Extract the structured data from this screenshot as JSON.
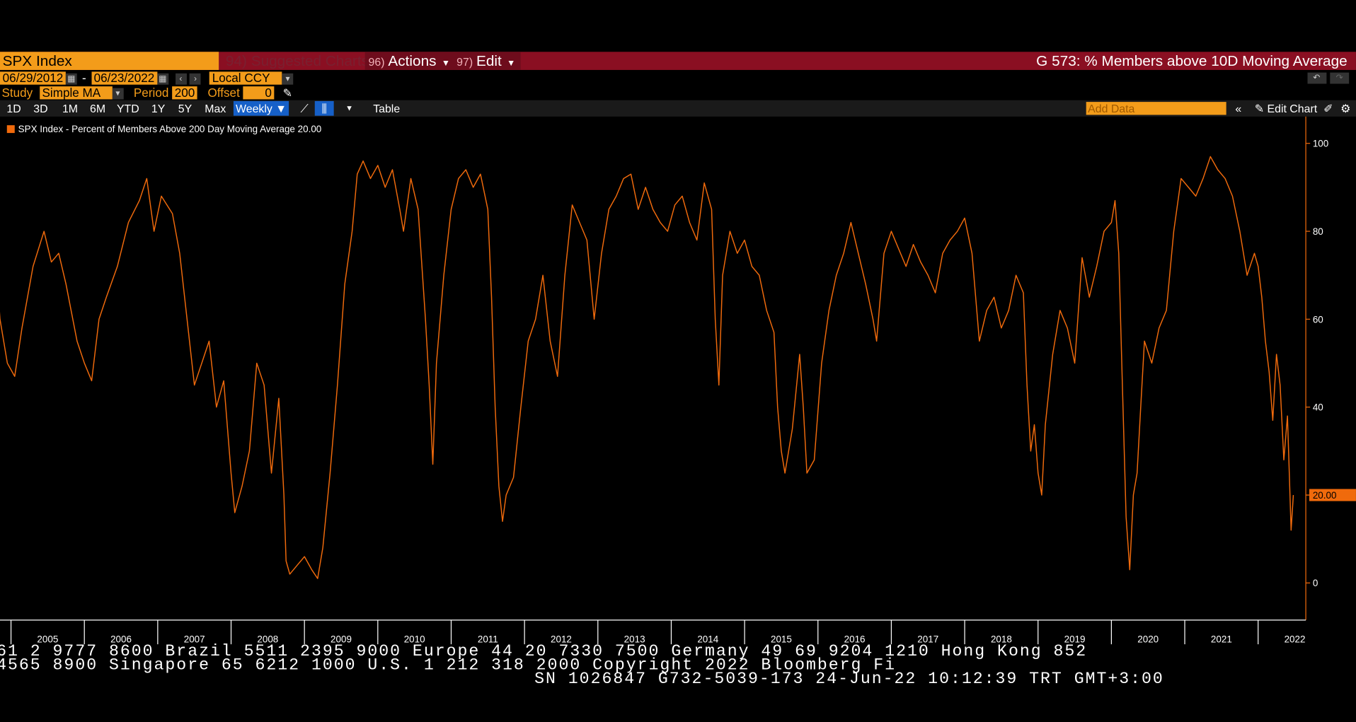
{
  "header": {
    "security": "SPX Index",
    "suggested": "94) Suggested Charts",
    "actions_num": "96)",
    "actions_label": "Actions",
    "edit_num": "97)",
    "edit_label": "Edit",
    "function_title": "G 573: % Members above 10D Moving Average"
  },
  "controls": {
    "start_date": "06/29/2012",
    "date_sep": "-",
    "end_date": "06/23/2022",
    "currency": "Local CCY",
    "study_label": "Study",
    "study_value": "Simple MA",
    "period_label": "Period",
    "period_value": "200",
    "offset_label": "Offset",
    "offset_value": "0"
  },
  "toolbar": {
    "ranges": [
      "1D",
      "3D",
      "1M",
      "6M",
      "YTD",
      "1Y",
      "5Y",
      "Max"
    ],
    "frequency": "Weekly",
    "table_label": "Table",
    "add_data_placeholder": "Add Data",
    "edit_chart_label": "Edit Chart"
  },
  "footer": {
    "line1": "61 2 9777 8600 Brazil 5511 2395 9000 Europe 44 20 7330 7500 Germany 49 69 9204 1210 Hong Kong 852",
    "line2": "4565 8900       Singapore 65 6212 1000      U.S. 1 212 318 2000       Copyright 2022 Bloomberg Fi",
    "line3": "SN 1026847 G732-5039-173 24-Jun-22 10:12:39 TRT   GMT+3:00"
  },
  "colors": {
    "accent": "#f39c1a",
    "series": "#f06a0c",
    "bar": "#8a0f22"
  },
  "chart_data": {
    "type": "line",
    "legend": "SPX Index - Percent of Members Above 200 Day Moving Average 20.00",
    "last_value_label": "20.00",
    "ylim": [
      0,
      100
    ],
    "y_ticks": [
      0,
      20,
      40,
      60,
      80,
      100
    ],
    "x_ticks": [
      "2005",
      "2006",
      "2007",
      "2008",
      "2009",
      "2010",
      "2011",
      "2012",
      "2013",
      "2014",
      "2015",
      "2016",
      "2017",
      "2018",
      "2019",
      "2020",
      "2021",
      "2022"
    ],
    "series": [
      {
        "points": [
          [
            2004.8,
            72
          ],
          [
            2004.85,
            60
          ],
          [
            2004.95,
            50
          ],
          [
            2005.05,
            47
          ],
          [
            2005.15,
            58
          ],
          [
            2005.3,
            72
          ],
          [
            2005.45,
            80
          ],
          [
            2005.55,
            73
          ],
          [
            2005.65,
            75
          ],
          [
            2005.75,
            68
          ],
          [
            2005.9,
            55
          ],
          [
            2006.0,
            50
          ],
          [
            2006.1,
            46
          ],
          [
            2006.2,
            60
          ],
          [
            2006.3,
            65
          ],
          [
            2006.45,
            72
          ],
          [
            2006.6,
            82
          ],
          [
            2006.75,
            87
          ],
          [
            2006.85,
            92
          ],
          [
            2006.95,
            80
          ],
          [
            2007.05,
            88
          ],
          [
            2007.2,
            84
          ],
          [
            2007.3,
            75
          ],
          [
            2007.4,
            60
          ],
          [
            2007.5,
            45
          ],
          [
            2007.6,
            50
          ],
          [
            2007.7,
            55
          ],
          [
            2007.8,
            40
          ],
          [
            2007.9,
            46
          ],
          [
            2008.0,
            25
          ],
          [
            2008.05,
            16
          ],
          [
            2008.15,
            22
          ],
          [
            2008.25,
            30
          ],
          [
            2008.35,
            50
          ],
          [
            2008.45,
            45
          ],
          [
            2008.55,
            25
          ],
          [
            2008.65,
            42
          ],
          [
            2008.72,
            20
          ],
          [
            2008.75,
            5
          ],
          [
            2008.8,
            2
          ],
          [
            2008.9,
            4
          ],
          [
            2009.0,
            6
          ],
          [
            2009.1,
            3
          ],
          [
            2009.18,
            1
          ],
          [
            2009.25,
            8
          ],
          [
            2009.35,
            25
          ],
          [
            2009.45,
            45
          ],
          [
            2009.55,
            68
          ],
          [
            2009.65,
            80
          ],
          [
            2009.72,
            93
          ],
          [
            2009.8,
            96
          ],
          [
            2009.9,
            92
          ],
          [
            2010.0,
            95
          ],
          [
            2010.1,
            90
          ],
          [
            2010.2,
            94
          ],
          [
            2010.3,
            85
          ],
          [
            2010.35,
            80
          ],
          [
            2010.45,
            92
          ],
          [
            2010.55,
            85
          ],
          [
            2010.65,
            60
          ],
          [
            2010.7,
            45
          ],
          [
            2010.75,
            27
          ],
          [
            2010.8,
            50
          ],
          [
            2010.9,
            70
          ],
          [
            2011.0,
            85
          ],
          [
            2011.1,
            92
          ],
          [
            2011.2,
            94
          ],
          [
            2011.3,
            90
          ],
          [
            2011.4,
            93
          ],
          [
            2011.5,
            85
          ],
          [
            2011.55,
            65
          ],
          [
            2011.6,
            40
          ],
          [
            2011.65,
            22
          ],
          [
            2011.7,
            14
          ],
          [
            2011.75,
            20
          ],
          [
            2011.85,
            24
          ],
          [
            2011.95,
            40
          ],
          [
            2012.05,
            55
          ],
          [
            2012.15,
            60
          ],
          [
            2012.25,
            70
          ],
          [
            2012.35,
            55
          ],
          [
            2012.45,
            47
          ],
          [
            2012.55,
            70
          ],
          [
            2012.65,
            86
          ],
          [
            2012.75,
            82
          ],
          [
            2012.85,
            78
          ],
          [
            2012.95,
            60
          ],
          [
            2013.05,
            75
          ],
          [
            2013.15,
            85
          ],
          [
            2013.25,
            88
          ],
          [
            2013.35,
            92
          ],
          [
            2013.45,
            93
          ],
          [
            2013.55,
            85
          ],
          [
            2013.65,
            90
          ],
          [
            2013.75,
            85
          ],
          [
            2013.85,
            82
          ],
          [
            2013.95,
            80
          ],
          [
            2014.05,
            86
          ],
          [
            2014.15,
            88
          ],
          [
            2014.25,
            82
          ],
          [
            2014.35,
            78
          ],
          [
            2014.45,
            91
          ],
          [
            2014.55,
            85
          ],
          [
            2014.6,
            60
          ],
          [
            2014.65,
            45
          ],
          [
            2014.7,
            70
          ],
          [
            2014.8,
            80
          ],
          [
            2014.9,
            75
          ],
          [
            2015.0,
            78
          ],
          [
            2015.1,
            72
          ],
          [
            2015.2,
            70
          ],
          [
            2015.3,
            62
          ],
          [
            2015.4,
            57
          ],
          [
            2015.45,
            40
          ],
          [
            2015.5,
            30
          ],
          [
            2015.55,
            25
          ],
          [
            2015.65,
            35
          ],
          [
            2015.75,
            52
          ],
          [
            2015.8,
            40
          ],
          [
            2015.85,
            25
          ],
          [
            2015.95,
            28
          ],
          [
            2016.05,
            50
          ],
          [
            2016.15,
            62
          ],
          [
            2016.25,
            70
          ],
          [
            2016.35,
            75
          ],
          [
            2016.45,
            82
          ],
          [
            2016.55,
            75
          ],
          [
            2016.65,
            68
          ],
          [
            2016.75,
            60
          ],
          [
            2016.8,
            55
          ],
          [
            2016.9,
            75
          ],
          [
            2017.0,
            80
          ],
          [
            2017.1,
            76
          ],
          [
            2017.2,
            72
          ],
          [
            2017.3,
            77
          ],
          [
            2017.4,
            73
          ],
          [
            2017.5,
            70
          ],
          [
            2017.6,
            66
          ],
          [
            2017.7,
            75
          ],
          [
            2017.8,
            78
          ],
          [
            2017.9,
            80
          ],
          [
            2018.0,
            83
          ],
          [
            2018.1,
            75
          ],
          [
            2018.2,
            55
          ],
          [
            2018.3,
            62
          ],
          [
            2018.4,
            65
          ],
          [
            2018.5,
            58
          ],
          [
            2018.6,
            62
          ],
          [
            2018.7,
            70
          ],
          [
            2018.8,
            66
          ],
          [
            2018.85,
            45
          ],
          [
            2018.9,
            30
          ],
          [
            2018.95,
            36
          ],
          [
            2019.0,
            25
          ],
          [
            2019.05,
            20
          ],
          [
            2019.1,
            36
          ],
          [
            2019.2,
            52
          ],
          [
            2019.3,
            62
          ],
          [
            2019.4,
            58
          ],
          [
            2019.5,
            50
          ],
          [
            2019.6,
            74
          ],
          [
            2019.7,
            65
          ],
          [
            2019.8,
            72
          ],
          [
            2019.9,
            80
          ],
          [
            2020.0,
            82
          ],
          [
            2020.05,
            87
          ],
          [
            2020.1,
            75
          ],
          [
            2020.15,
            45
          ],
          [
            2020.2,
            15
          ],
          [
            2020.25,
            3
          ],
          [
            2020.3,
            20
          ],
          [
            2020.35,
            25
          ],
          [
            2020.4,
            40
          ],
          [
            2020.45,
            55
          ],
          [
            2020.55,
            50
          ],
          [
            2020.65,
            58
          ],
          [
            2020.75,
            62
          ],
          [
            2020.85,
            80
          ],
          [
            2020.95,
            92
          ],
          [
            2021.05,
            90
          ],
          [
            2021.15,
            88
          ],
          [
            2021.25,
            92
          ],
          [
            2021.35,
            97
          ],
          [
            2021.45,
            94
          ],
          [
            2021.55,
            92
          ],
          [
            2021.65,
            88
          ],
          [
            2021.75,
            80
          ],
          [
            2021.85,
            70
          ],
          [
            2021.95,
            75
          ],
          [
            2022.0,
            72
          ],
          [
            2022.05,
            65
          ],
          [
            2022.1,
            55
          ],
          [
            2022.15,
            48
          ],
          [
            2022.2,
            37
          ],
          [
            2022.25,
            52
          ],
          [
            2022.3,
            45
          ],
          [
            2022.35,
            28
          ],
          [
            2022.4,
            38
          ],
          [
            2022.45,
            12
          ],
          [
            2022.48,
            20
          ]
        ]
      }
    ]
  }
}
